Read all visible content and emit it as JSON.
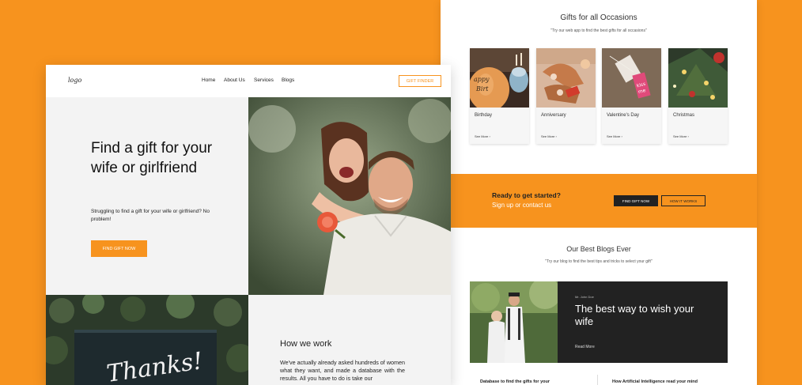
{
  "back": {
    "occasions": {
      "title": "Gifts for all Occasions",
      "subtitle": "\"Try our web app to find the best gifts for all occasions\"",
      "cards": [
        {
          "name": "Birthday",
          "more": "See More ›"
        },
        {
          "name": "Anniversary",
          "more": "See More ›"
        },
        {
          "name": "Valentine's Day",
          "more": "See More ›"
        },
        {
          "name": "Christmas",
          "more": "See More ›"
        }
      ]
    },
    "cta": {
      "line1": "Ready to get started?",
      "line2": "Sign up or contact us",
      "primary": "FIND GIFT NOW",
      "secondary": "HOW IT WORKS"
    },
    "blogs": {
      "title": "Our Best Blogs Ever",
      "subtitle": "\"Try our blog to find the best tips and tricks to select your gift\"",
      "featured": {
        "author": "Mr. John Doe",
        "headline": "The best way to wish your wife",
        "more": "Read More"
      },
      "columns": [
        "Database to find the gifts for your",
        "How Artificial Intelligence read your mind"
      ]
    }
  },
  "front": {
    "nav": {
      "logo": "logo",
      "links": [
        "Home",
        "About Us",
        "Services",
        "Blogs"
      ],
      "button": "GIFT FINDER"
    },
    "hero": {
      "heading": "Find a gift for your wife or girlfriend",
      "text": "Struggling to find a gift for your wife or girlfriend?  No problem!",
      "button": "FIND GIFT NOW"
    },
    "thanks_card": "Thanks!",
    "how": {
      "title": "How we work",
      "body": "We've actually already asked hundreds of women what they want, and made a database with the results. All you have to do is take our"
    }
  },
  "colors": {
    "accent": "#F7931E",
    "dark": "#222222"
  }
}
